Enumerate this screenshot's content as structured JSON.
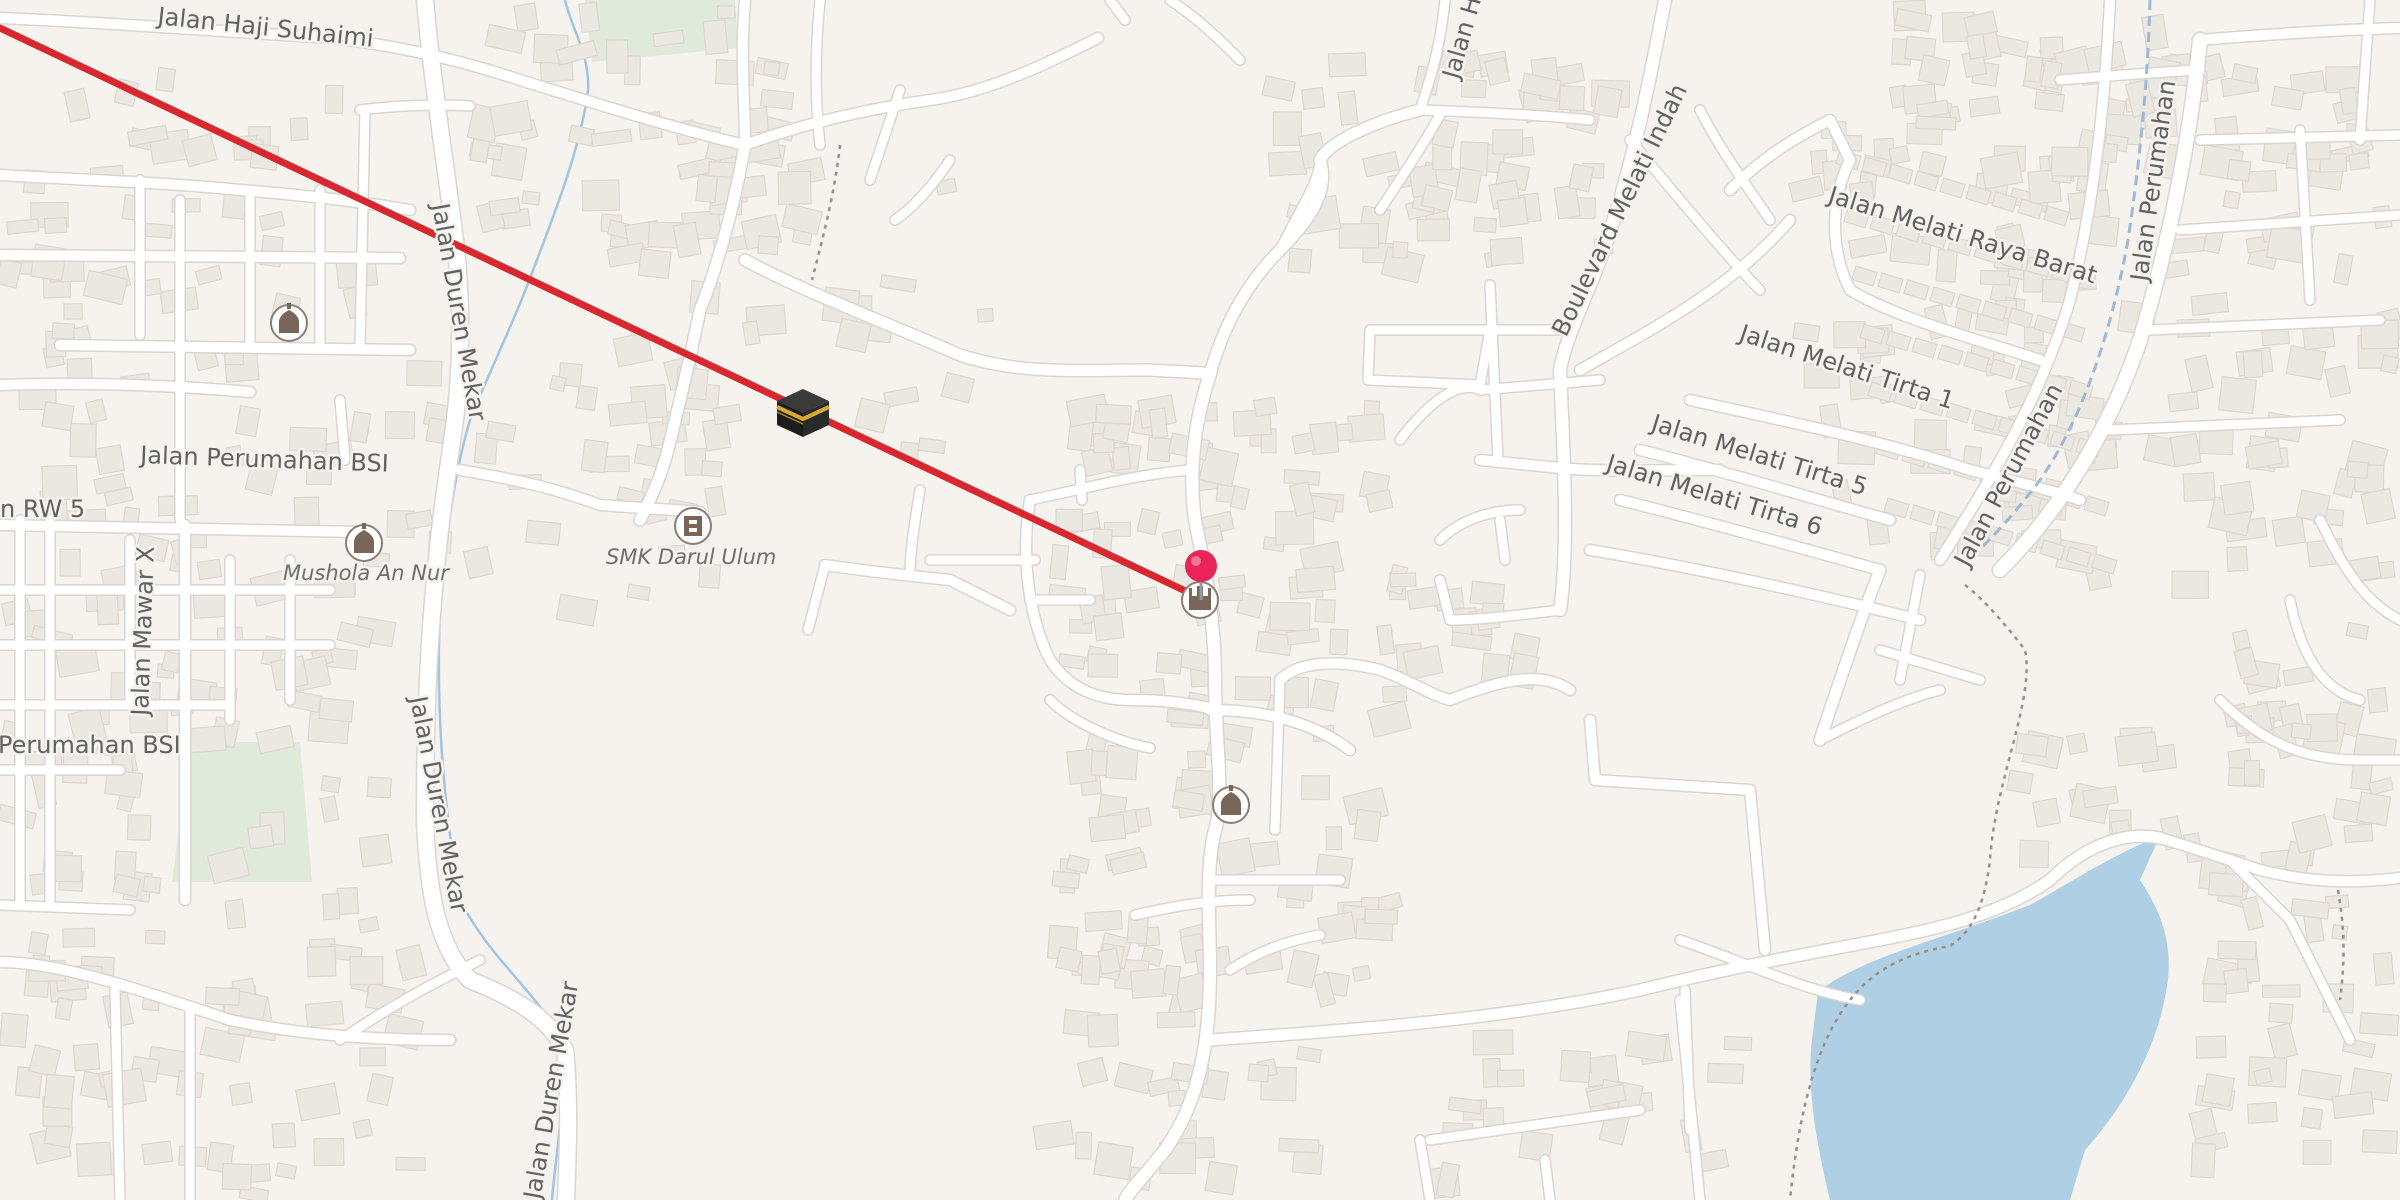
{
  "map": {
    "street_labels": [
      "Jalan Haji Suhaimi",
      "Jalan Duren Mekar",
      "Jalan Duren Mekar",
      "Jalan Duren Mekar",
      "Jalan Perumahan BSI",
      "Perumahan BSI",
      "Jalan Mawar X",
      "n RW 5",
      "Boulevard Melati Indah",
      "Jalan H",
      "Jalan Melati Raya Barat",
      "Jalan Melati Tirta 1",
      "Jalan Melati Tirta 5",
      "Jalan Melati Tirta 6",
      "Jalan Perumahan",
      "Jalan Perumahan"
    ],
    "poi_labels": [
      "SMK Darul Ulum",
      "Mushola An Nur"
    ],
    "icons": [
      "kaaba-icon",
      "location-pin-icon",
      "mosque-icon",
      "school-icon"
    ],
    "colors": {
      "background": "#f6f3ef",
      "road": "#ffffff",
      "building": "#ebe7e1",
      "water": "#aecfe4",
      "park": "#dfeadb",
      "qibla_line": "#d8272e",
      "pin": "#e8245a"
    }
  }
}
